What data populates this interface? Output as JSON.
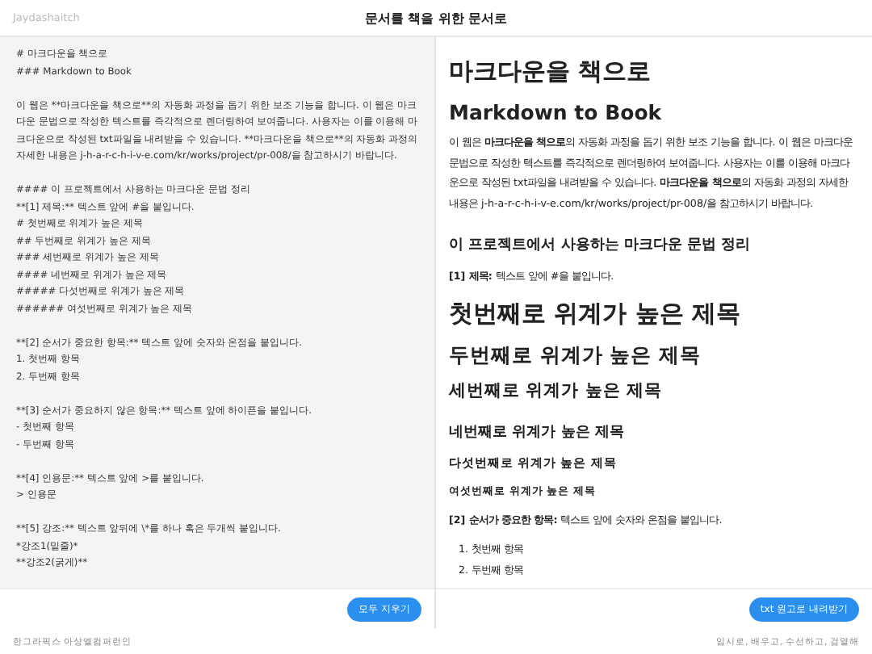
{
  "header": {
    "brand": "Jaydashaitch",
    "title": "문서를 책을 위한 문서로"
  },
  "editor": {
    "blocks": [
      [
        "# 마크다운을 책으로",
        "### Markdown to Book"
      ],
      [
        "이 웹은 **마크다운을 책으로**의 자동화 과정을 돕기 위한 보조 기능을 합니다. 이 웹은 마크다운 문법으로 작성한 텍스트를 즉각적으로 렌더링하여 보여줍니다. 사용자는 이를 이용해 마크다운으로 작성된 txt파일을 내려받을 수 있습니다. **마크다운을 책으로**의 자동화 과정의 자세한 내용은 j-h-a-r-c-h-i-v-e.com/kr/works/project/pr-008/을 참고하시기 바랍니다."
      ],
      [
        "#### 이 프로젝트에서 사용하는 마크다운 문법 정리",
        "**[1] 제목:** 텍스트 앞에 #을 붙입니다.",
        "# 첫번째로 위계가 높은 제목",
        "## 두번째로 위계가 높은 제목",
        "### 세번째로 위계가 높은 제목",
        "#### 네번째로 위계가 높은 제목",
        "##### 다섯번째로 위계가 높은 제목",
        "###### 여섯번째로 위계가 높은 제목"
      ],
      [
        "**[2] 순서가 중요한 항목:** 텍스트 앞에 숫자와 온점을 붙입니다.",
        "1. 첫번째 항목",
        "2. 두번째 항목"
      ],
      [
        "**[3] 순서가 중요하지 않은 항목:** 텍스트 앞에 하이픈을 붙입니다.",
        "- 첫번째 항목",
        "- 두번째 항목"
      ],
      [
        "**[4] 인용문:** 텍스트 앞에 >를 붙입니다.",
        "> 인용문"
      ],
      [
        "**[5] 강조:** 텍스트 앞뒤에 \\*를 하나 혹은 두개씩 붙입니다.",
        "*강조1(밑줄)*",
        "**강조2(굵게)**"
      ]
    ],
    "button": "모두 지우기"
  },
  "preview": {
    "blocks": [
      {
        "kind": "h1",
        "text": "마크다운을 책으로"
      },
      {
        "kind": "h2",
        "text": "Markdown to Book"
      },
      {
        "kind": "p",
        "text": "이 웹은 **마크다운을 책으로**의 자동화 과정을 돕기 위한 보조 기능을 합니다. 이 웹은 마크다운 문법으로 작성한 텍스트를 즉각적으로 렌더링하여 보여줍니다. 사용자는 이를 이용해 마크다운으로 작성된 txt파일을 내려받을 수 있습니다. **마크다운을 책으로**의 자동화 과정의 자세한 내용은 j-h-a-r-c-h-i-v-e.com/kr/works/project/pr-008/을 참고하시기 바랍니다."
      },
      {
        "kind": "h4",
        "text": "이 프로젝트에서 사용하는 마크다운 문법 정리"
      },
      {
        "kind": "p",
        "text": "**[1] 제목:** 텍스트 앞에 #을 붙입니다."
      },
      {
        "kind": "h1",
        "text": "첫번째로 위계가 높은 제목"
      },
      {
        "kind": "h2",
        "text": "두번째로 위계가 높은 제목"
      },
      {
        "kind": "h3",
        "text": "세번째로 위계가 높은 제목"
      },
      {
        "kind": "h4",
        "text": "네번째로 위계가 높은 제목"
      },
      {
        "kind": "h5",
        "text": "다섯번째로 위계가 높은 제목"
      },
      {
        "kind": "h6",
        "text": "여섯번째로 위계가 높은 제목"
      },
      {
        "kind": "p",
        "text": "**[2] 순서가 중요한 항목:** 텍스트 앞에 숫자와 온점을 붙입니다."
      },
      {
        "kind": "ol",
        "items": [
          "1. 첫번째 항목",
          "2. 두번째 항목"
        ]
      }
    ],
    "button": "txt 원고로 내려받기"
  },
  "footer": {
    "left": "한그라픽스 아상엘컴퍼런인",
    "right": "임시로, 배우고, 수선하고, 검열해"
  }
}
